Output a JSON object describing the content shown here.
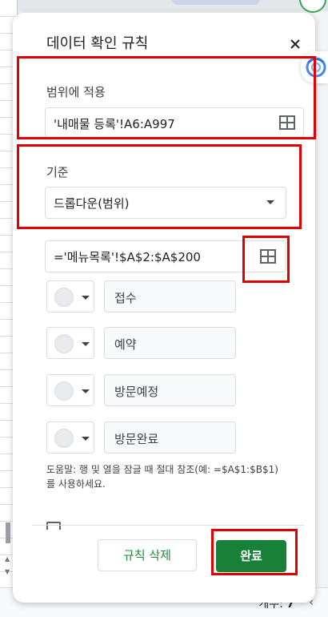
{
  "dialog": {
    "title": "데이터 확인 규칙",
    "apply_range_label": "범위에 적용",
    "apply_range_value": "'내매물 등록'!A6:A997",
    "criteria_label": "기준",
    "criteria_value": "드롭다운(범위)",
    "criteria_range_value": "='메뉴목록'!$A$2:$A$200",
    "items": [
      {
        "label": "접수"
      },
      {
        "label": "예약"
      },
      {
        "label": "방문예정"
      },
      {
        "label": "방문완료"
      }
    ],
    "help_text": "도움말: 행 및 열을 잠글 때 절대 참조(예: =$A$1:$B$1)를 사용하세요.",
    "delete_button": "규칙 삭제",
    "done_button": "완료"
  },
  "sheet": {
    "count_label": "개수:",
    "count_value": "7"
  },
  "colors": {
    "accent": "#188038",
    "highlight": "#e00000"
  }
}
